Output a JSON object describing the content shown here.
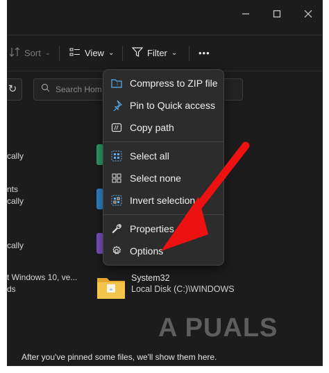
{
  "toolbar": {
    "sort_label": "Sort",
    "view_label": "View",
    "filter_label": "Filter",
    "more_label": "•••"
  },
  "search": {
    "placeholder": "Search Hom"
  },
  "left_items": [
    "cally",
    "nts",
    "cally",
    "cally",
    "t Windows 10, ve...",
    "ds"
  ],
  "system_item": {
    "title": "System32",
    "subtitle": "Local Disk (C:)\\WINDOWS"
  },
  "footer": {
    "message": "After you've pinned some files, we'll show them here."
  },
  "context_menu": {
    "compress": "Compress to ZIP file",
    "pin": "Pin to Quick access",
    "copy_path": "Copy path",
    "select_all": "Select all",
    "select_none": "Select none",
    "invert": "Invert selection",
    "properties": "Properties",
    "options": "Options"
  },
  "watermark": "A PUALS",
  "colors": {
    "accent": "#5ab0f5",
    "arrow": "#ee1111",
    "folder_yellow": "#f3c64b"
  }
}
